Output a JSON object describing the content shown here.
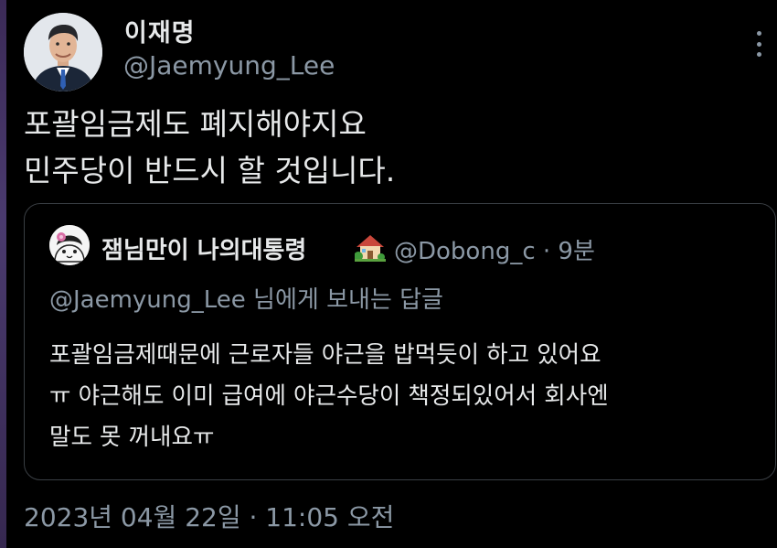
{
  "tweet": {
    "author_name": "이재명",
    "author_handle": "@Jaemyung_Lee",
    "text_lines": [
      "포괄임금제도 폐지해야지요",
      "민주당이 반드시 할 것입니다."
    ],
    "timestamp": "2023년 04월 22일 · 11:05 오전",
    "more_icon": "more-vertical-icon"
  },
  "quoted_tweet": {
    "author_name": "잼님만이 나의대통령",
    "name_emoji": "house-with-garden-icon",
    "meta": "@Dobong_c · 9분",
    "reply_to": "@Jaemyung_Lee 님에게 보내는 답글",
    "text_lines": [
      "포괄임금제때문에 근로자들 야근을 밥먹듯이 하고 있어요",
      "ㅠ 야근해도 이미 급여에 야근수당이 책정되있어서 회사엔",
      "말도 못 꺼내요ㅠ"
    ]
  },
  "colors": {
    "background": "#000000",
    "primary_text": "#e7e9ea",
    "secondary_text": "#8b98a5",
    "border": "#3a3f44"
  }
}
